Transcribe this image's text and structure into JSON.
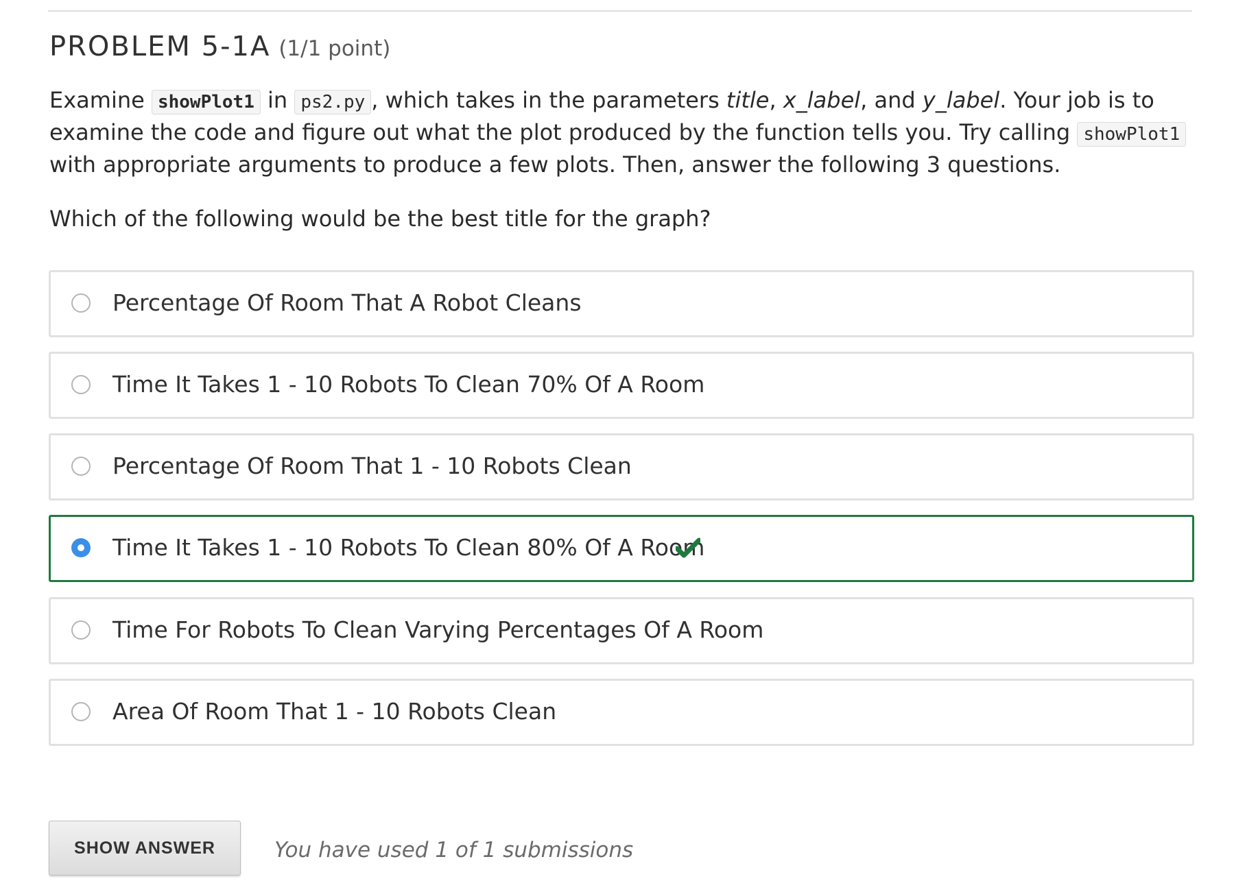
{
  "problem": {
    "title": "PROBLEM 5-1A",
    "points": "(1/1 point)"
  },
  "description": {
    "examine": "Examine ",
    "code_function": "showPlot1",
    "in": " in ",
    "code_file": "ps2.py",
    "which_takes": ", which takes in the parameters ",
    "param_title": "title",
    "comma1": ", ",
    "param_x": "x_label",
    "and": ", and ",
    "param_y": "y_label",
    "rest1": ". Your job is to examine the code and figure out what the plot produced by the function tells you. Try calling ",
    "code_function_2": "showPlot1",
    "rest2": " with appropriate arguments to produce a few plots. Then, answer the following 3 questions."
  },
  "question": "Which of the following would be the best title for the graph?",
  "choices": [
    {
      "label": "Percentage Of Room That A Robot Cleans",
      "selected": false
    },
    {
      "label": "Time It Takes 1 - 10 Robots To Clean 70% Of A Room",
      "selected": false
    },
    {
      "label": "Percentage Of Room That 1 - 10 Robots Clean",
      "selected": false
    },
    {
      "label": "Time It Takes 1 - 10 Robots To Clean 80% Of A Room",
      "selected": true,
      "correct": true
    },
    {
      "label": "Time For Robots To Clean Varying Percentages Of A Room",
      "selected": false
    },
    {
      "label": "Area Of Room That 1 - 10 Robots Clean",
      "selected": false
    }
  ],
  "show_answer_label": "SHOW ANSWER",
  "submission_status": "You have used 1 of 1 submissions",
  "colors": {
    "correct_border": "#1e7a3c",
    "checkmark": "#1e7a3c",
    "radio_selected": "#3b8fe6"
  },
  "icons": {
    "correct": "checkmark-icon"
  }
}
